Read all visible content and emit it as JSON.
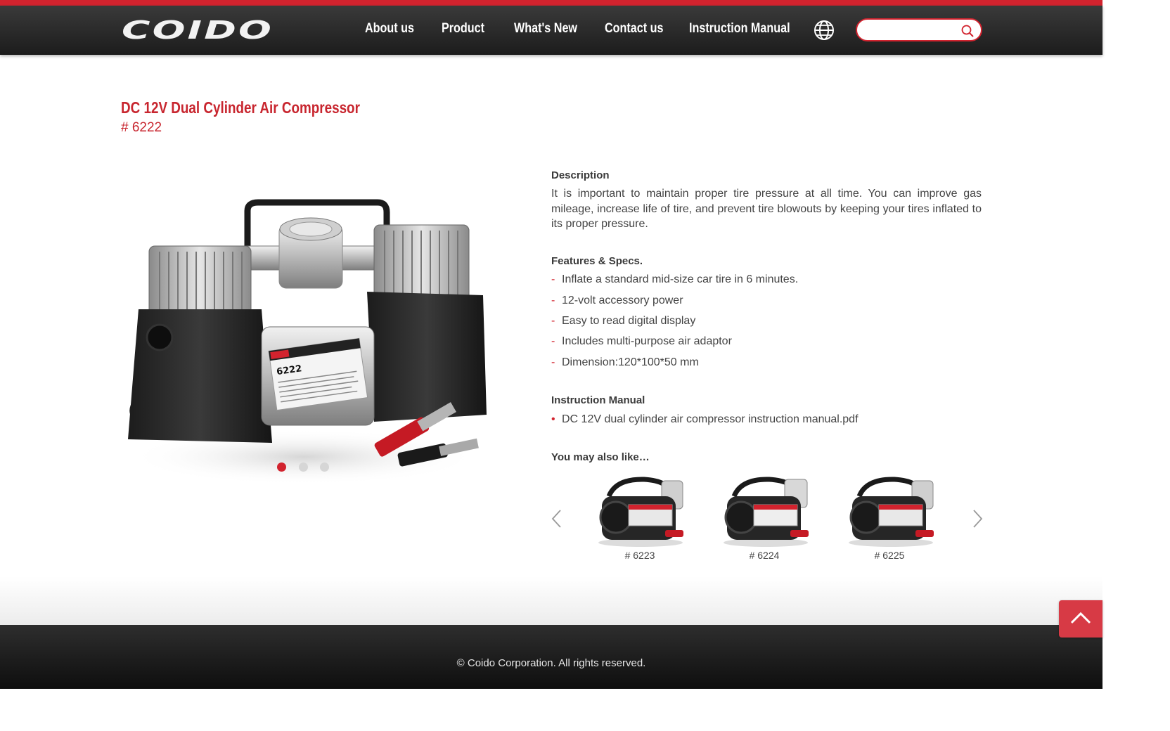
{
  "header": {
    "logo_text": "COIDO",
    "nav": [
      {
        "label": "About us"
      },
      {
        "label": "Product"
      },
      {
        "label": "What's New"
      },
      {
        "label": "Contact us"
      },
      {
        "label": "Instruction Manual"
      }
    ],
    "language_icon": "globe-icon",
    "search": {
      "placeholder": "",
      "value": "",
      "icon": "search-icon"
    }
  },
  "product": {
    "title": "DC 12V Dual Cylinder Air Compressor",
    "code": "# 6222",
    "image_label": "6222",
    "slider": {
      "count": 3,
      "active_index": 0
    }
  },
  "description": {
    "heading": "Description",
    "text": "It is important to maintain proper tire pressure at all time. You can improve gas mileage, increase life of tire, and prevent tire blowouts by keeping your tires inflated to its proper pressure."
  },
  "features": {
    "heading": "Features & Specs.",
    "items": [
      "Inflate a standard mid-size car tire in 6 minutes.",
      "12-volt accessory power",
      "Easy to read digital display",
      "Includes multi-purpose air adaptor",
      "Dimension:120*100*50 mm"
    ]
  },
  "manual": {
    "heading": "Instruction Manual",
    "items": [
      "DC 12V dual cylinder air compressor instruction manual.pdf"
    ]
  },
  "related": {
    "heading": "You may also like…",
    "items": [
      {
        "label": "# 6223"
      },
      {
        "label": "# 6224"
      },
      {
        "label": "# 6225"
      }
    ]
  },
  "footer": {
    "copyright": "© Coido Corporation. All rights reserved."
  },
  "colors": {
    "accent": "#d2232e",
    "header_bg": "#2a2a2a",
    "text": "#444444"
  }
}
